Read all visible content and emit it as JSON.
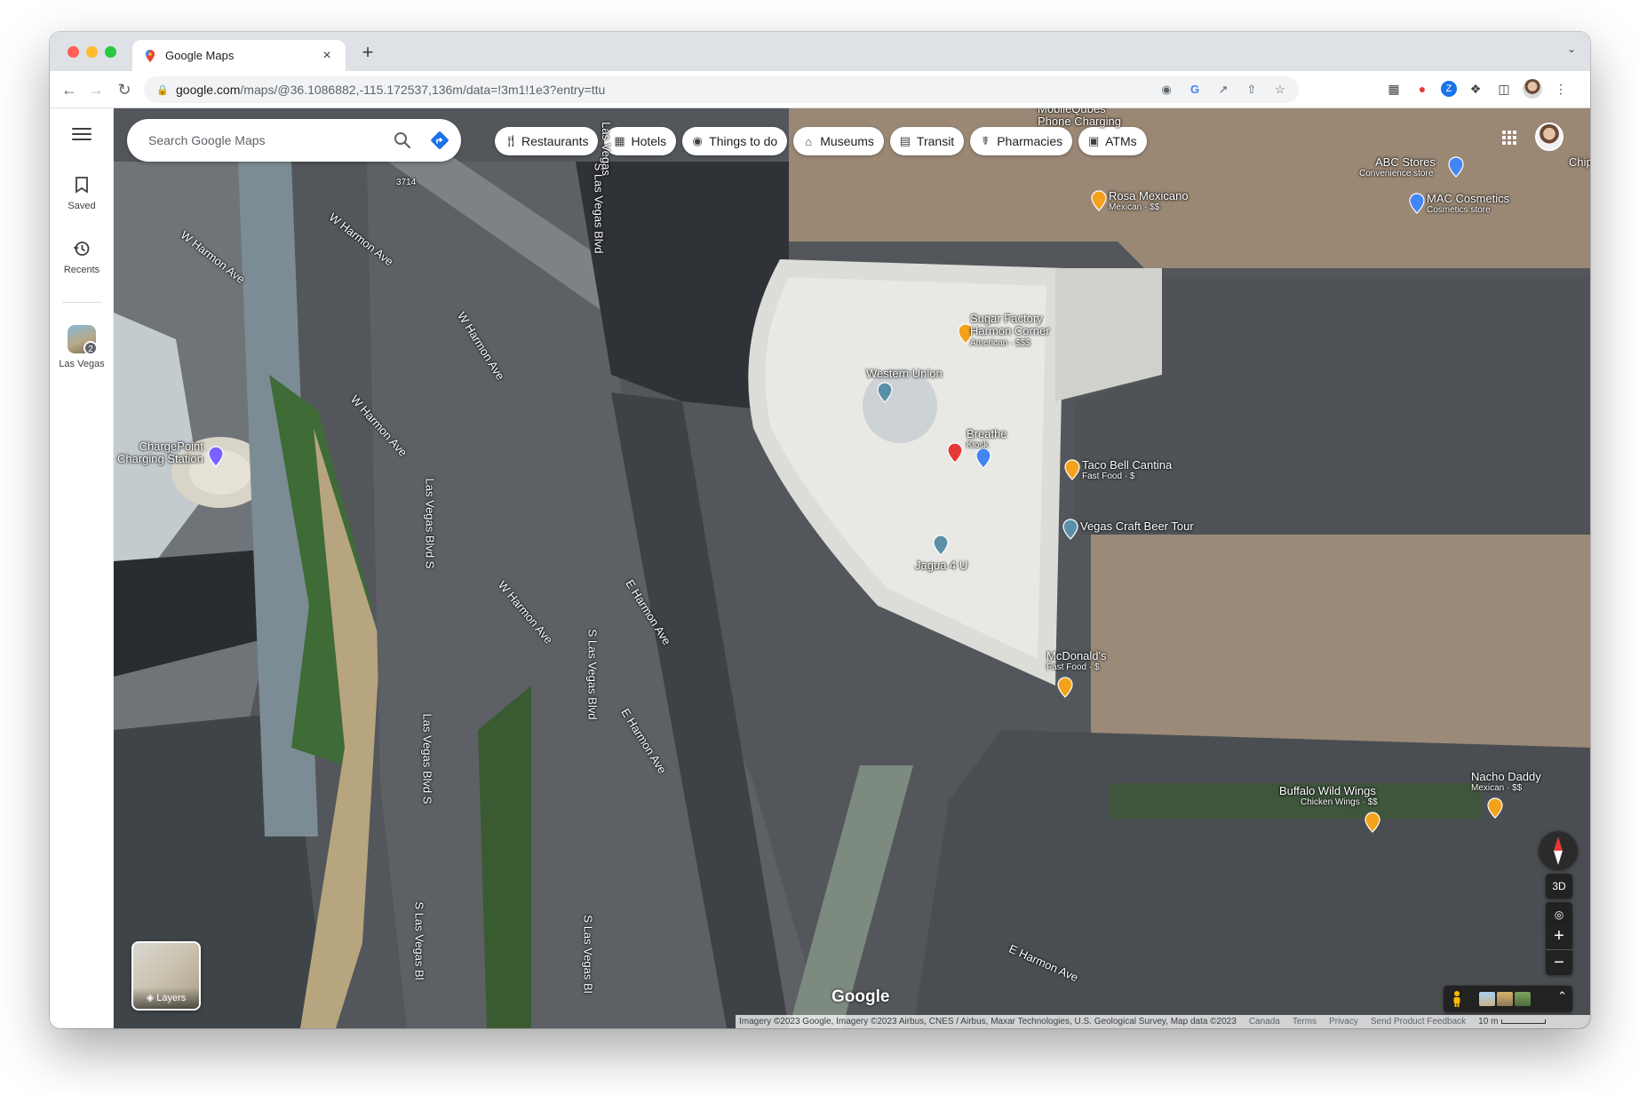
{
  "browser": {
    "tab_title": "Google Maps",
    "url_host": "google.com",
    "url_path": "/maps/@36.1086882,-115.172537,136m/data=!3m1!1e3?entry=ttu",
    "new_tab_symbol": "+",
    "close_symbol": "×"
  },
  "sidebar": {
    "saved_label": "Saved",
    "recents_label": "Recents",
    "recent_place_label": "Las Vegas",
    "recent_place_count": "2"
  },
  "search": {
    "placeholder": "Search Google Maps"
  },
  "chips": [
    {
      "label": "Restaurants",
      "icon": "fork-knife-icon"
    },
    {
      "label": "Hotels",
      "icon": "bed-icon"
    },
    {
      "label": "Things to do",
      "icon": "camera-icon"
    },
    {
      "label": "Museums",
      "icon": "museum-icon"
    },
    {
      "label": "Transit",
      "icon": "train-icon"
    },
    {
      "label": "Pharmacies",
      "icon": "pharmacy-icon"
    },
    {
      "label": "ATMs",
      "icon": "atm-icon"
    }
  ],
  "streets": [
    "W Harmon Ave",
    "W Harmon Ave",
    "W Harmon Ave",
    "W Harmon Ave",
    "W Harmon Ave",
    "S Las Vegas Blvd",
    "Las Vegas Blvd S",
    "S Las Vegas Blvd",
    "Las Vegas Blvd S",
    "S Las Vegas Bl",
    "S Las Vegas Bl",
    "Las Vegas",
    "E Harmon Ave",
    "E Harmon Ave",
    "E Harmon Ave",
    "3714"
  ],
  "pois": [
    {
      "name": "Rosa Mexicano",
      "sub": "Mexican · $$",
      "color": "#f4a21b"
    },
    {
      "name": "ABC Stores",
      "sub": "Convenience store",
      "color": "#4285f4"
    },
    {
      "name": "MAC Cosmetics",
      "sub": "Cosmetics store",
      "color": "#4285f4"
    },
    {
      "name": "Sugar Factory\nHarmon Corner",
      "sub": "American · $$$",
      "color": "#f4a21b"
    },
    {
      "name": "Western Union",
      "sub": "",
      "color": "#5b8fa8"
    },
    {
      "name": "Breathe",
      "sub": "Kiosk",
      "color": "#4285f4"
    },
    {
      "name": "Taco Bell Cantina",
      "sub": "Fast Food · $",
      "color": "#f4a21b"
    },
    {
      "name": "Vegas Craft Beer Tour",
      "sub": "",
      "color": "#5b8fa8"
    },
    {
      "name": "Jagua 4 U",
      "sub": "",
      "color": "#5b8fa8"
    },
    {
      "name": "McDonald's",
      "sub": "Fast Food · $",
      "color": "#f4a21b"
    },
    {
      "name": "Buffalo Wild Wings",
      "sub": "Chicken Wings · $$",
      "color": "#f4a21b"
    },
    {
      "name": "Nacho Daddy",
      "sub": "Mexican · $$",
      "color": "#f4a21b"
    },
    {
      "name": "ChargePoint\nCharging Station",
      "sub": "",
      "color": "#7b61ff"
    },
    {
      "name": "MobileQubes\nPhone Charging",
      "sub": "",
      "color": "#5b8fa8"
    },
    {
      "name": "Chip",
      "sub": "",
      "color": "#5b8fa8"
    }
  ],
  "controls": {
    "layers_label": "Layers",
    "three_d_label": "3D",
    "zoom_in": "+",
    "zoom_out": "−",
    "google_logo": "Google"
  },
  "attribution": {
    "imagery": "Imagery ©2023 Google, Imagery ©2023 Airbus, CNES / Airbus, Maxar Technologies, U.S. Geological Survey, Map data ©2023",
    "canada": "Canada",
    "terms": "Terms",
    "privacy": "Privacy",
    "feedback": "Send Product Feedback",
    "scale": "10 m"
  }
}
